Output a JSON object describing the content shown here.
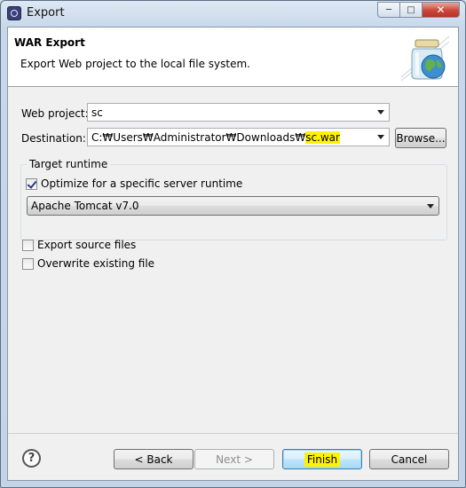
{
  "window": {
    "title": "Export",
    "caption_icons": [
      "minimize-icon",
      "maximize-icon",
      "close-icon"
    ]
  },
  "banner": {
    "title": "WAR Export",
    "description": "Export Web project to the local file system.",
    "graphic_icon": "jar-globe-icon"
  },
  "web_project": {
    "label": "Web project:",
    "value": "sc"
  },
  "destination": {
    "label": "Destination:",
    "value_prefix": "C:₩Users₩Administrator₩Downloads₩",
    "value_highlight": "sc.war",
    "browse_label": "Browse..."
  },
  "target_runtime": {
    "group_title": "Target runtime",
    "optimize_label": "Optimize for a specific server runtime",
    "optimize_checked": true,
    "runtime_value": "Apache Tomcat v7.0"
  },
  "options": {
    "export_source_label": "Export source files",
    "export_source_checked": false,
    "overwrite_label": "Overwrite existing file",
    "overwrite_checked": false
  },
  "footer": {
    "help_symbol": "?",
    "back_label": "< Back",
    "next_label": "Next >",
    "finish_label": "Finish",
    "cancel_label": "Cancel"
  },
  "colors": {
    "highlight": "#fff200",
    "title_bar": "#c8d8ea",
    "close_button": "#c9473a"
  }
}
